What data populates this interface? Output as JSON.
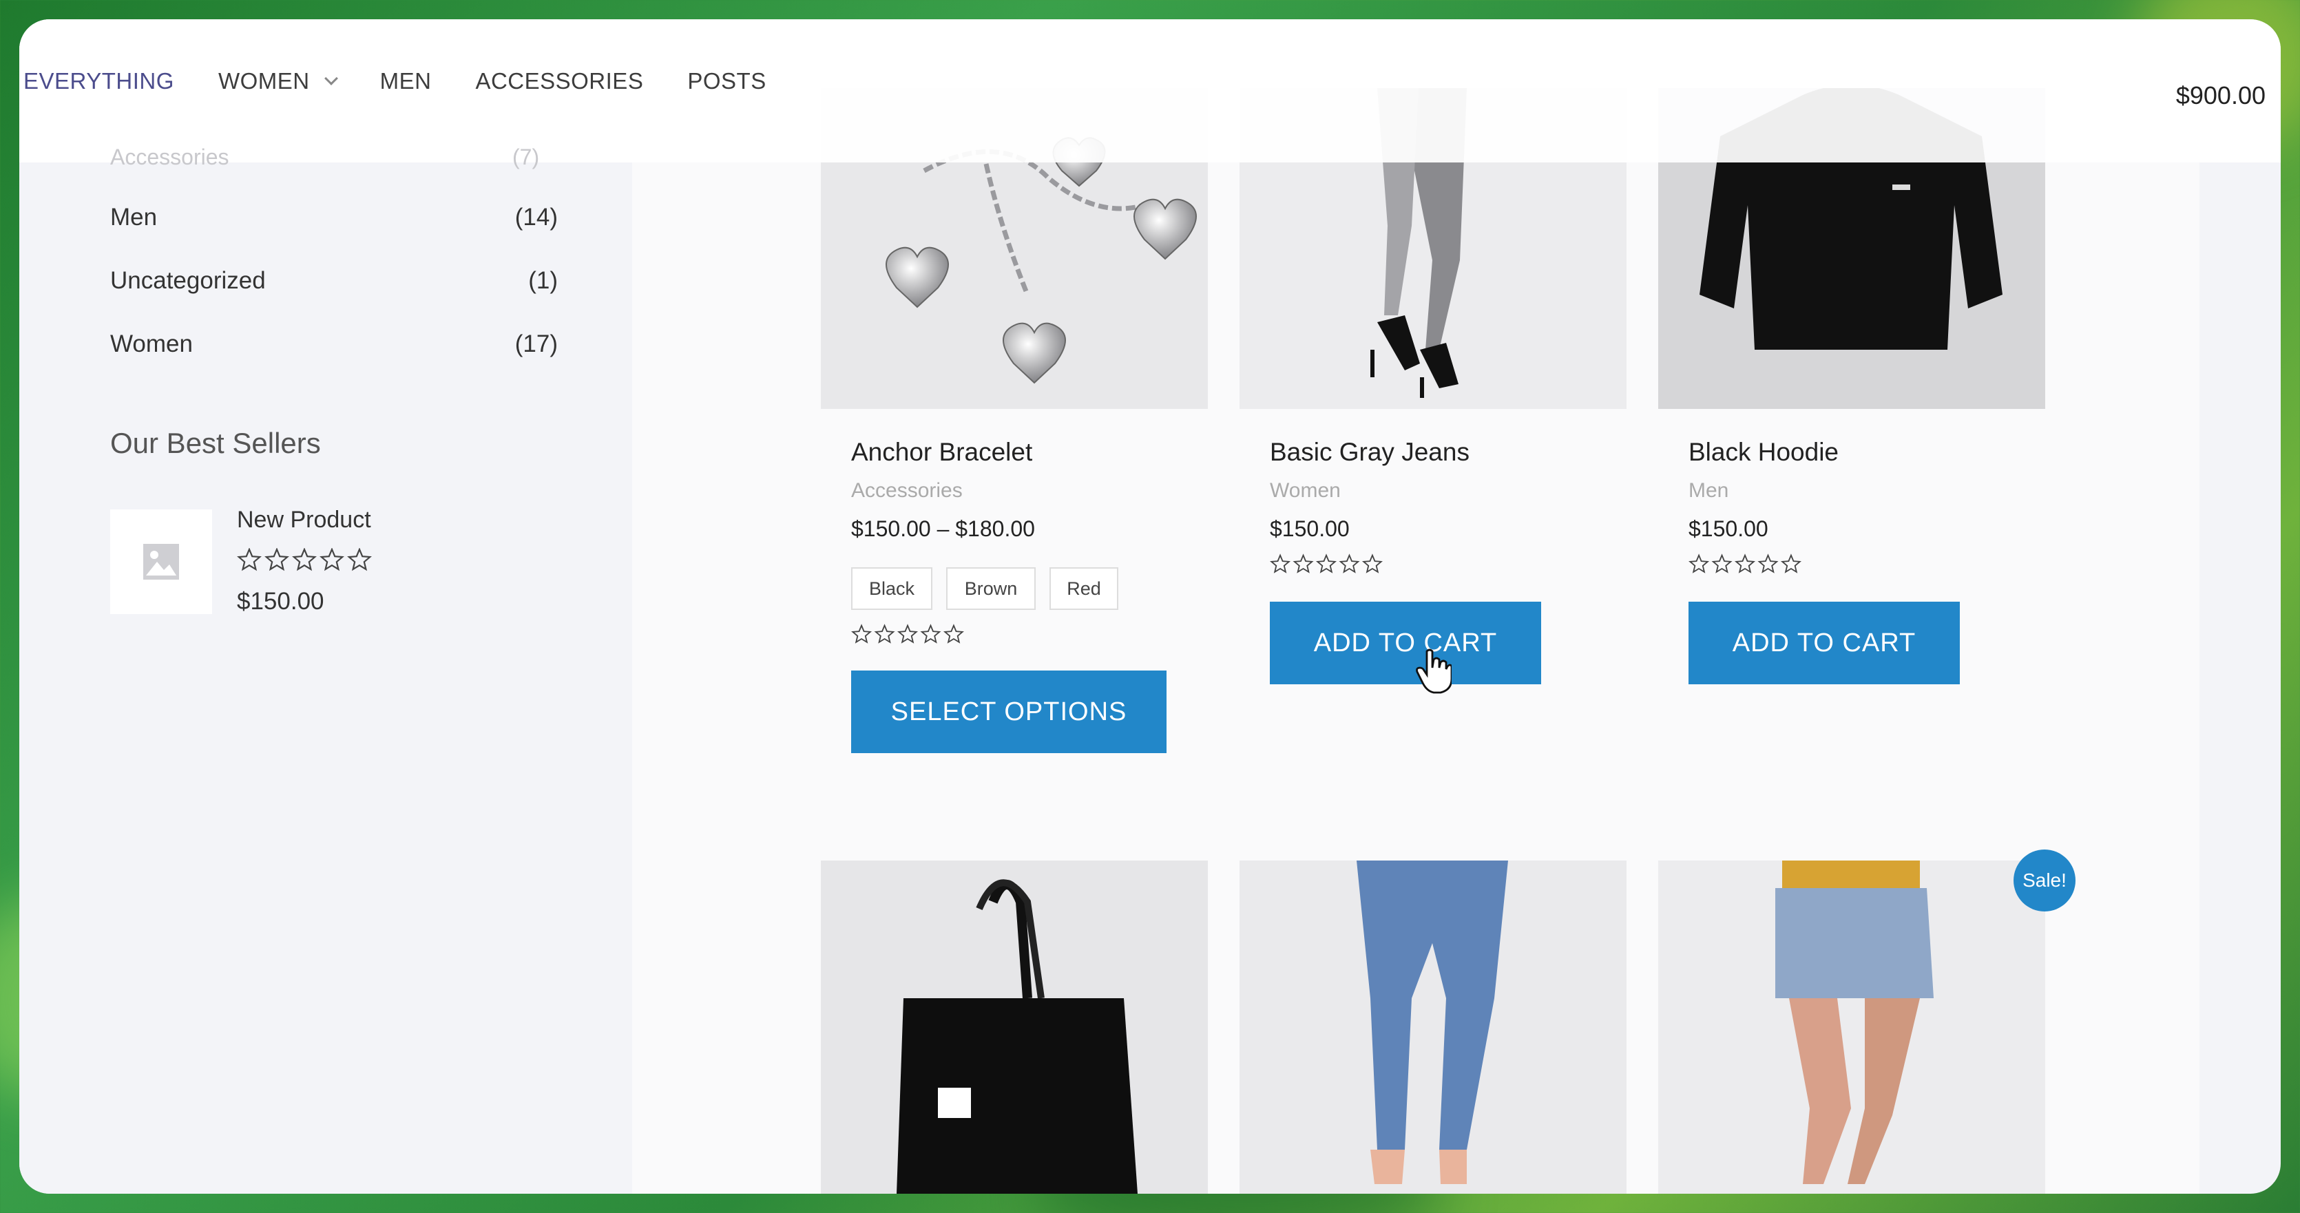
{
  "nav": {
    "items": [
      "EVERYTHING",
      "WOMEN",
      "MEN",
      "ACCESSORIES",
      "POSTS"
    ],
    "cart_total": "$900.00"
  },
  "sidebar": {
    "faded_category": "Accessories",
    "faded_count": "(7)",
    "categories": [
      {
        "name": "Men",
        "count": "(14)"
      },
      {
        "name": "Uncategorized",
        "count": "(1)"
      },
      {
        "name": "Women",
        "count": "(17)"
      }
    ],
    "best_sellers_title": "Our Best Sellers",
    "best_seller": {
      "name": "New Product",
      "price": "$150.00",
      "rating": 0
    }
  },
  "products": [
    {
      "title": "Anchor Bracelet",
      "category": "Accessories",
      "price": "$150.00 – $180.00",
      "swatches": [
        "Black",
        "Brown",
        "Red"
      ],
      "button": "SELECT OPTIONS",
      "rating": 0
    },
    {
      "title": "Basic Gray Jeans",
      "category": "Women",
      "price": "$150.00",
      "button": "ADD TO CART",
      "rating": 0
    },
    {
      "title": "Black Hoodie",
      "category": "Men",
      "price": "$150.00",
      "button": "ADD TO CART",
      "rating": 0
    }
  ],
  "second_row": {
    "sale_badge": "Sale!"
  },
  "colors": {
    "accent": "#2287c9",
    "nav_active": "#4b4c8c",
    "background_green": "#2c8a3a"
  }
}
